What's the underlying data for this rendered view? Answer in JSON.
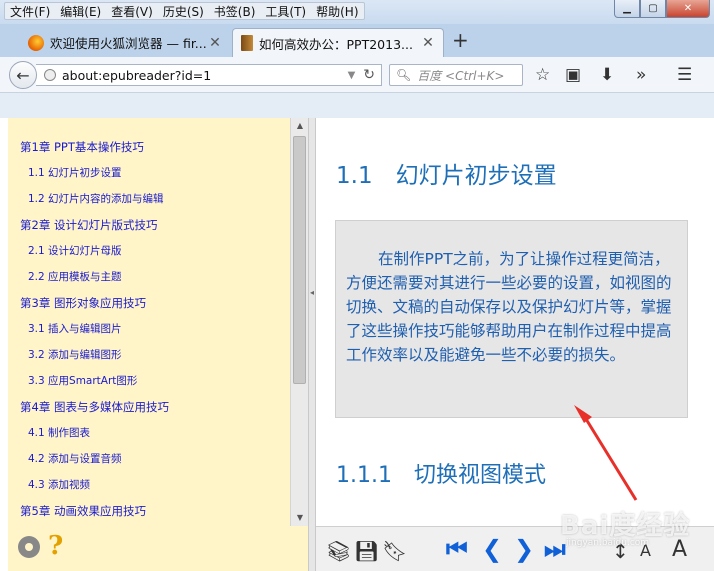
{
  "menu": [
    "文件(F)",
    "编辑(E)",
    "查看(V)",
    "历史(S)",
    "书签(B)",
    "工具(T)",
    "帮助(H)"
  ],
  "window_controls": {
    "minimize": "▁",
    "maximize": "▢",
    "close": "✕"
  },
  "tabs": [
    {
      "title": "欢迎使用火狐浏览器 — fir...",
      "close": "✕"
    },
    {
      "title": "如何高效办公：PPT2013...",
      "close": "✕"
    }
  ],
  "new_tab": "+",
  "navbar": {
    "url": "about:epubreader?id=1",
    "search_placeholder": "百度 <Ctrl+K>"
  },
  "toc": [
    {
      "label": "第1章 PPT基本操作技巧",
      "level": "chapter"
    },
    {
      "label": "1.1 幻灯片初步设置",
      "level": "section"
    },
    {
      "label": "1.2 幻灯片内容的添加与编辑",
      "level": "section"
    },
    {
      "label": "第2章 设计幻灯片版式技巧",
      "level": "chapter"
    },
    {
      "label": "2.1 设计幻灯片母版",
      "level": "section"
    },
    {
      "label": "2.2 应用模板与主题",
      "level": "section"
    },
    {
      "label": "第3章 图形对象应用技巧",
      "level": "chapter"
    },
    {
      "label": "3.1 插入与编辑图片",
      "level": "section"
    },
    {
      "label": "3.2 添加与编辑图形",
      "level": "section"
    },
    {
      "label": "3.3 应用SmartArt图形",
      "level": "section"
    },
    {
      "label": "第4章 图表与多媒体应用技巧",
      "level": "chapter"
    },
    {
      "label": "4.1 制作图表",
      "level": "section"
    },
    {
      "label": "4.2 添加与设置音频",
      "level": "section"
    },
    {
      "label": "4.3 添加视频",
      "level": "section"
    },
    {
      "label": "第5章 动画效果应用技巧",
      "level": "chapter"
    }
  ],
  "reader": {
    "heading1": "1.1　幻灯片初步设置",
    "paragraph": "在制作PPT之前，为了让操作过程更简洁，方便还需要对其进行一些必要的设置，如视图的切换、文稿的自动保存以及保护幻灯片等，掌握了这些操作技巧能够帮助用户在制作过程中提高工作效率以及能避免一些不必要的损失。",
    "heading2": "1.1.1　切换视图模式"
  },
  "help_glyph": "?",
  "font_controls": {
    "smaller": "A",
    "larger": "A"
  },
  "watermark": {
    "main": "Bai度经验",
    "sub": "jingyan.baidu.com"
  },
  "colors": {
    "toc_bg": "#fff5c9",
    "link": "#1a1ad0",
    "heading": "#1f6fb8",
    "arrow": "#e8302a"
  }
}
